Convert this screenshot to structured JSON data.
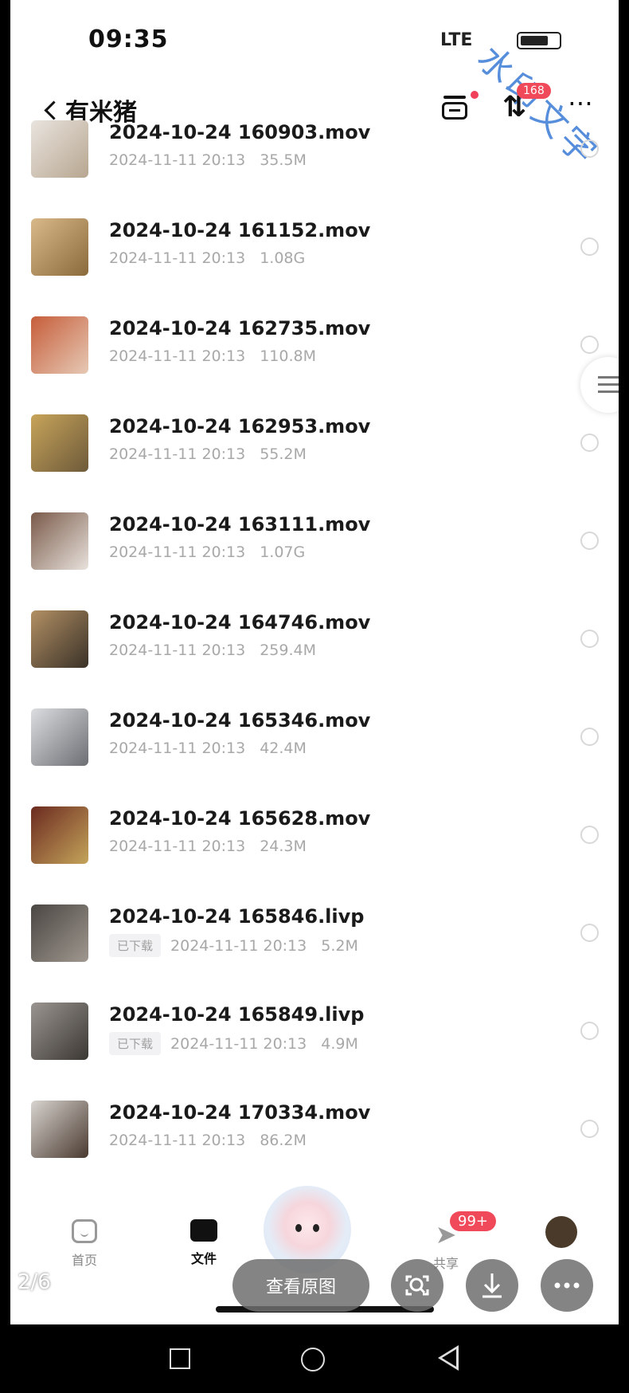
{
  "status": {
    "time": "09:35",
    "signal": "LTE"
  },
  "watermark": "水印文字",
  "header": {
    "title": "有米猪",
    "transfer_badge": "168"
  },
  "files": [
    {
      "name": "2024-10-24 160903.mov",
      "date": "2024-11-11 20:13",
      "size": "35.5M",
      "downloaded": false
    },
    {
      "name": "2024-10-24 161152.mov",
      "date": "2024-11-11 20:13",
      "size": "1.08G",
      "downloaded": false
    },
    {
      "name": "2024-10-24 162735.mov",
      "date": "2024-11-11 20:13",
      "size": "110.8M",
      "downloaded": false
    },
    {
      "name": "2024-10-24 162953.mov",
      "date": "2024-11-11 20:13",
      "size": "55.2M",
      "downloaded": false
    },
    {
      "name": "2024-10-24 163111.mov",
      "date": "2024-11-11 20:13",
      "size": "1.07G",
      "downloaded": false
    },
    {
      "name": "2024-10-24 164746.mov",
      "date": "2024-11-11 20:13",
      "size": "259.4M",
      "downloaded": false
    },
    {
      "name": "2024-10-24 165346.mov",
      "date": "2024-11-11 20:13",
      "size": "42.4M",
      "downloaded": false
    },
    {
      "name": "2024-10-24 165628.mov",
      "date": "2024-11-11 20:13",
      "size": "24.3M",
      "downloaded": false
    },
    {
      "name": "2024-10-24 165846.livp",
      "date": "2024-11-11 20:13",
      "size": "5.2M",
      "downloaded": true
    },
    {
      "name": "2024-10-24 165849.livp",
      "date": "2024-11-11 20:13",
      "size": "4.9M",
      "downloaded": true
    },
    {
      "name": "2024-10-24 170334.mov",
      "date": "2024-11-11 20:13",
      "size": "86.2M",
      "downloaded": false
    }
  ],
  "downloaded_label": "已下载",
  "tabs": {
    "home": "首页",
    "files": "文件",
    "share": "共享",
    "share_badge": "99+"
  },
  "viewer": {
    "pager": "2/6",
    "view_original": "查看原图"
  },
  "colors": {
    "badge": "#f04a5a",
    "watermark": "#3a7bd5"
  }
}
